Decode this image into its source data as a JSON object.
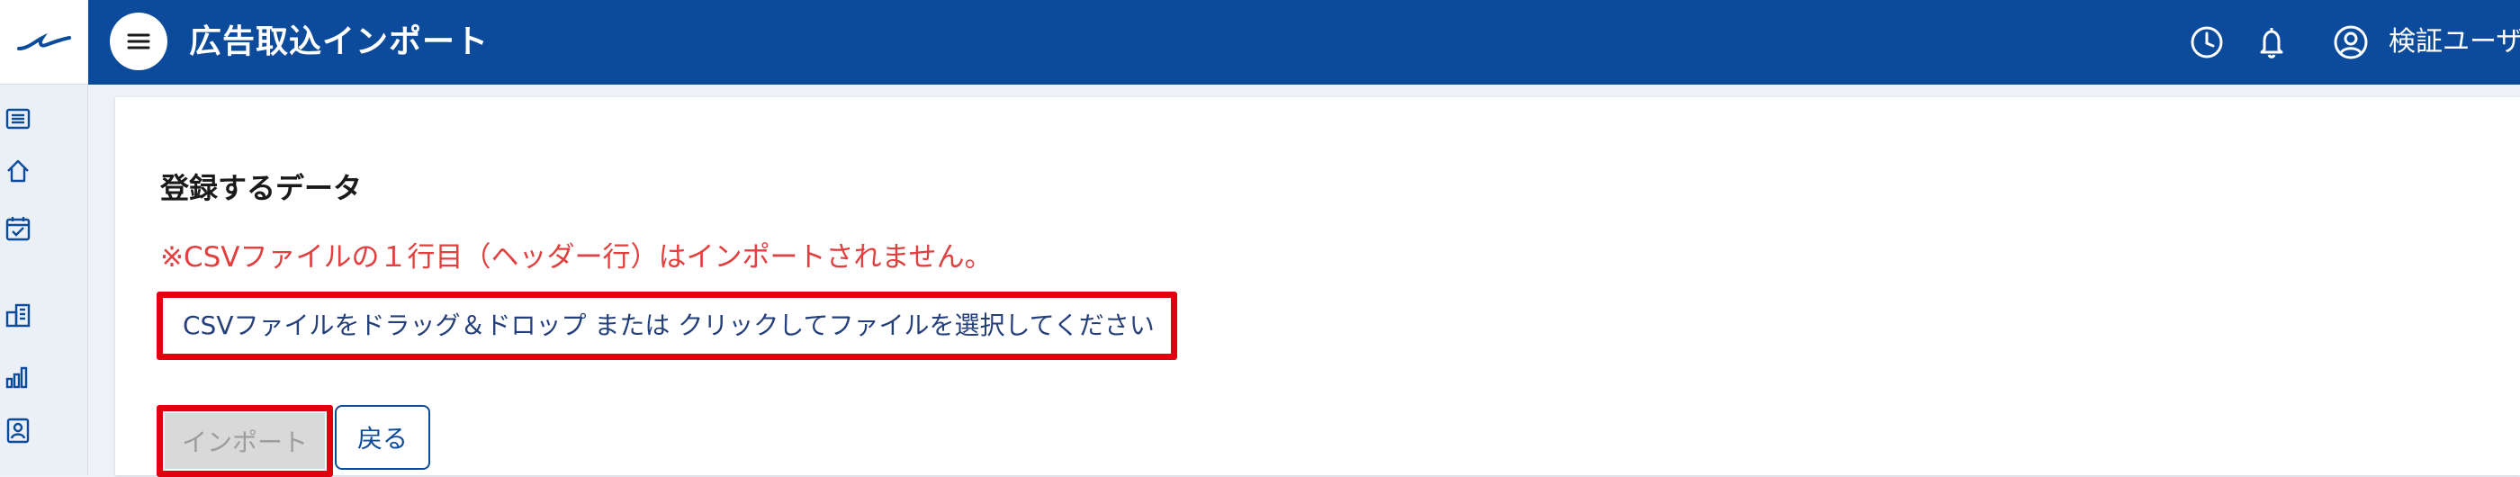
{
  "header": {
    "title": "広告取込インポート",
    "user_name": "検証ユーザー",
    "bg_color": "#0c4a9b"
  },
  "rail": {
    "items": [
      {
        "icon": "list-icon"
      },
      {
        "icon": "home-icon"
      },
      {
        "icon": "calendar-check-icon"
      },
      {
        "icon": "building-icon"
      },
      {
        "icon": "bar-chart-icon"
      },
      {
        "icon": "contact-card-icon"
      }
    ]
  },
  "main": {
    "section_title": "登録するデータ",
    "warning": "※CSVファイルの１行目（ヘッダー行）はインポートされません。",
    "dropzone_label": "CSVファイルをドラッグ＆ドロップ または クリックしてファイルを選択してください",
    "import_button": "インポート",
    "back_button": "戻る"
  },
  "colors": {
    "accent": "#0c4a9b",
    "warning": "#e0403f",
    "highlight": "#e2000e"
  }
}
